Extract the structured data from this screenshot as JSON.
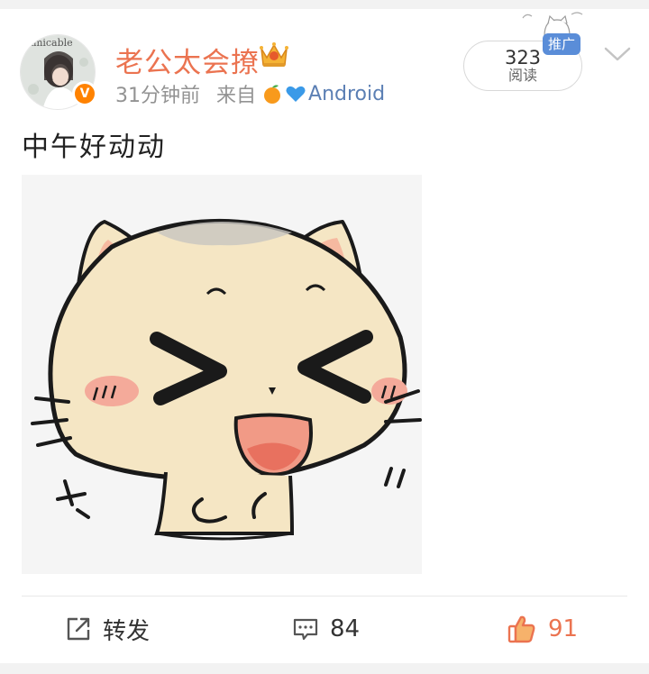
{
  "post": {
    "avatar_watermark": "Amicable",
    "username": "老公太会撩",
    "time": "31分钟前",
    "source_prefix": "来自",
    "source_device": "Android",
    "read_count": "323",
    "read_label": "阅读",
    "promo_label": "推广",
    "text": "中午好动动"
  },
  "actions": {
    "repost_label": "转发",
    "comment_count": "84",
    "like_count": "91"
  },
  "icons": {
    "verified": "verified-v-badge",
    "crown": "crown-icon",
    "source_emoji": [
      "orange-emoji",
      "blue-heart-emoji"
    ],
    "more": "chevron-down-icon",
    "repost": "repost-icon",
    "comment": "comment-icon",
    "like": "thumbs-up-icon"
  },
  "colors": {
    "username": "#eb7350",
    "meta": "#939393",
    "promo": "#5a8dd8",
    "like": "#eb7350"
  }
}
